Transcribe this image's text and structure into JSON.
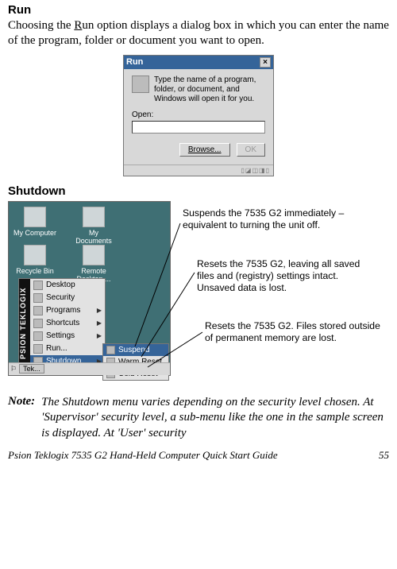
{
  "headings": {
    "run": "Run",
    "shutdown": "Shutdown"
  },
  "paragraphs": {
    "run_body_pre": "Choosing the ",
    "run_body_link": "R",
    "run_body_post_link": "un",
    "run_body_rest": " option displays a dialog box in which you can enter the name of the program, folder or document you want to open."
  },
  "run_dialog": {
    "title": "Run",
    "close_glyph": "×",
    "prompt": "Type the name of a program, folder, or document, and Windows will open it for you.",
    "open_label": "Open:",
    "browse": "Browse...",
    "ok": "OK",
    "tray": "▯◪◫◨▯"
  },
  "desktop": {
    "icons": [
      "My Computer",
      "My Documents",
      "Recycle Bin",
      "Remote Desktop ..."
    ]
  },
  "start_strip": "PSION TEKLOGIX",
  "start_menu": [
    "Desktop",
    "Security",
    "Programs",
    "Shortcuts",
    "Settings",
    "Run...",
    "Shutdown"
  ],
  "submenu": [
    "Suspend",
    "Warm Reset",
    "Cold Reset"
  ],
  "taskbar": {
    "start": "Tek...",
    "flag": "⚐"
  },
  "callouts": {
    "suspend": "Suspends the 7535 G2 immediately – equivalent to turning the unit off.",
    "warm": "Resets the 7535 G2, leaving all saved files and (registry) settings intact. Unsaved data is lost.",
    "cold": "Resets the 7535 G2. Files stored outside of permanent memory are lost."
  },
  "note": {
    "label": "Note:",
    "text": "The Shutdown menu varies depending on the security level chosen. At 'Supervisor' security level, a sub-menu like the one in the sample screen is displayed. At 'User' security"
  },
  "footer": {
    "left": "Psion Teklogix 7535 G2 Hand-Held Computer Quick Start Guide",
    "page": "55"
  }
}
